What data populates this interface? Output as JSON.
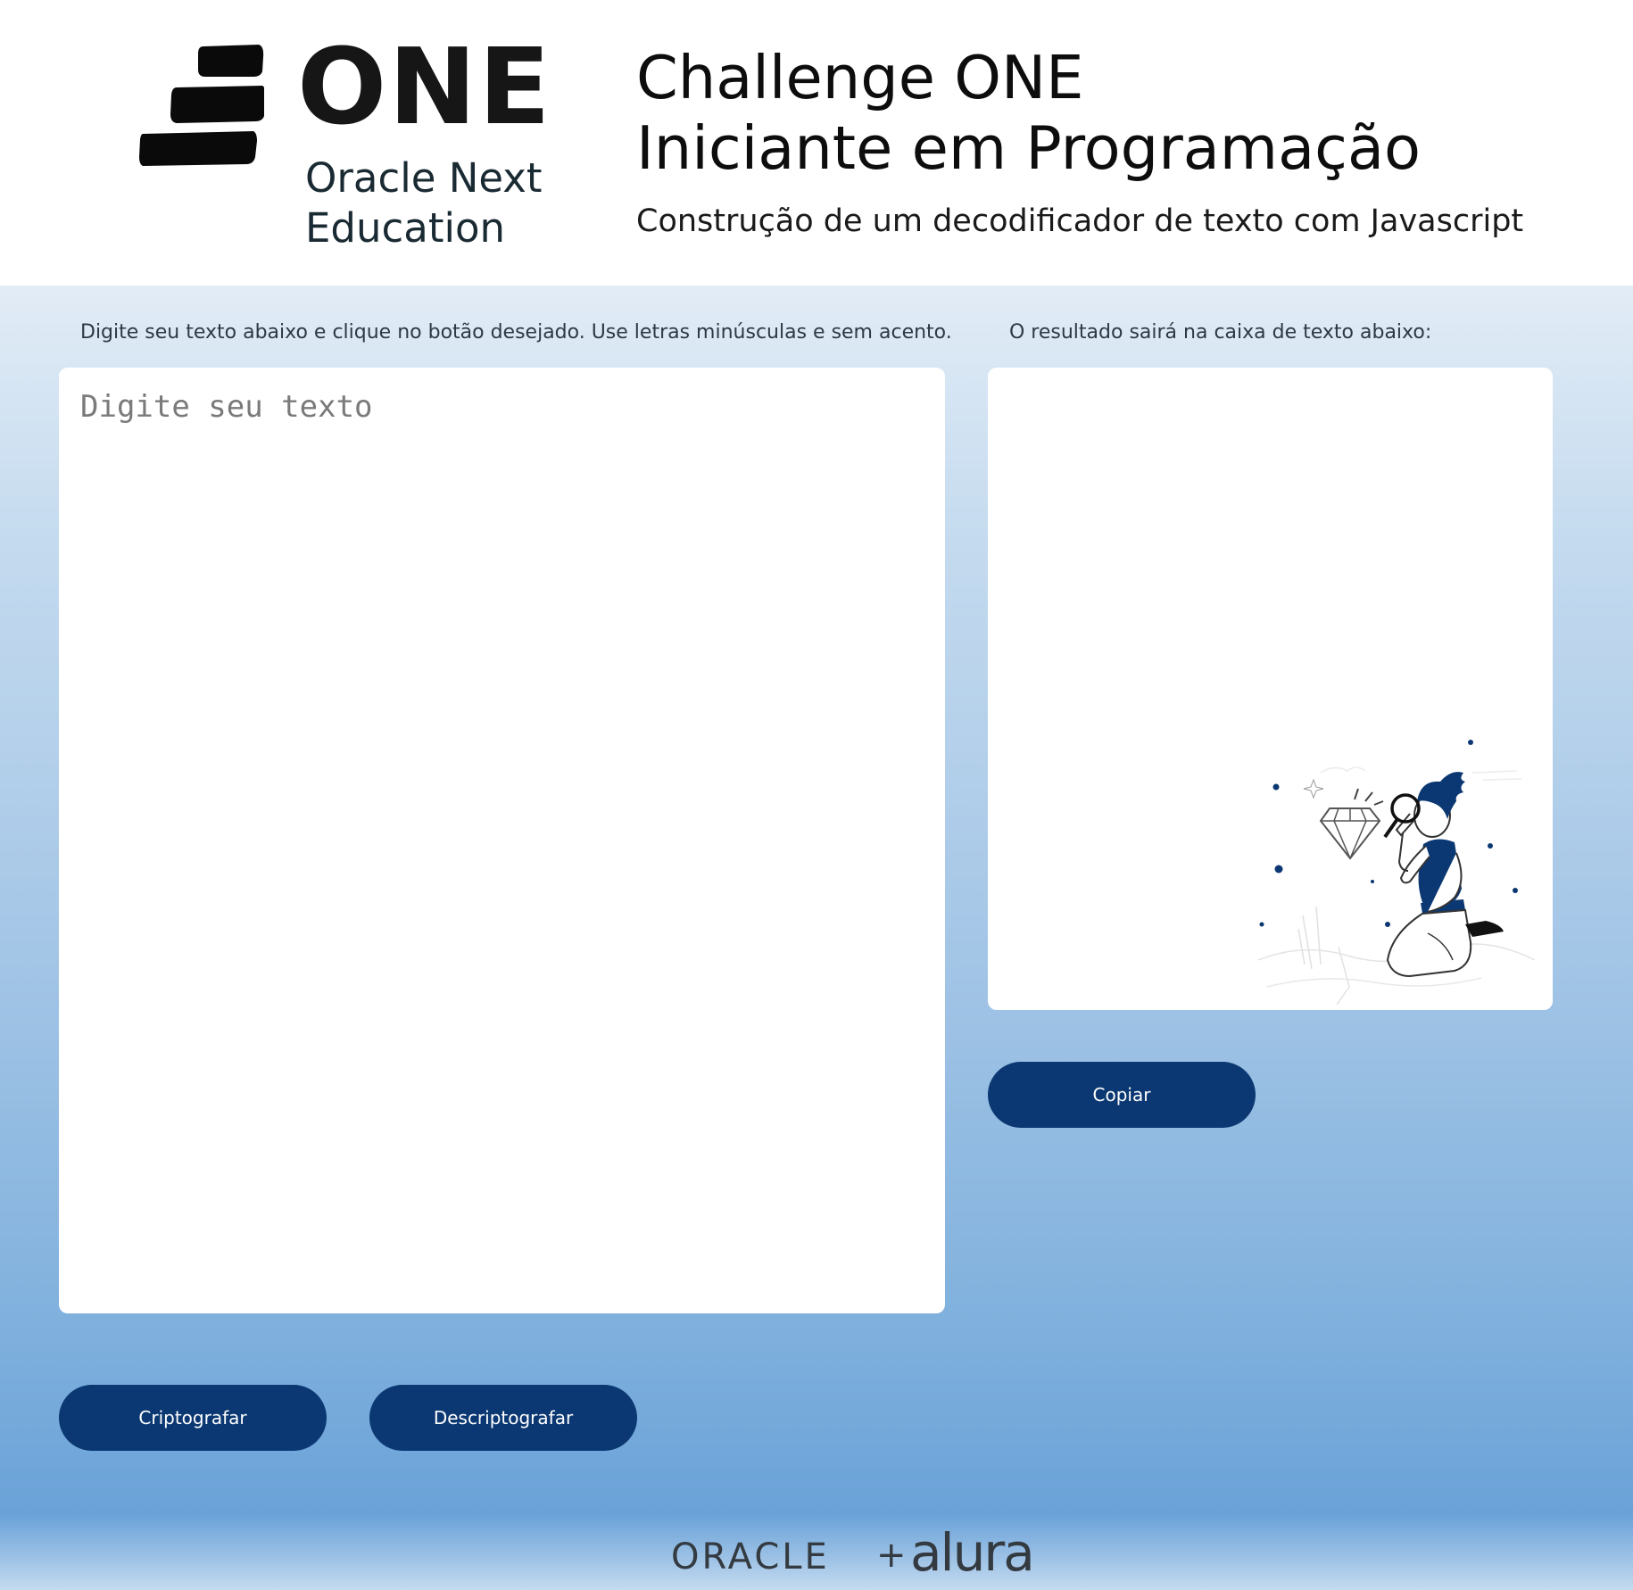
{
  "header": {
    "logo_word": "ONE",
    "logo_sub_line1": "Oracle Next",
    "logo_sub_line2": "Education",
    "title_line1": "Challenge ONE",
    "title_line2": "Iniciante em Programação",
    "subtitle": "Construção de um decodificador de texto com Javascript"
  },
  "input_panel": {
    "instruction": "Digite seu texto abaixo e clique no botão desejado. Use letras minúsculas e sem acento.",
    "placeholder": "Digite seu texto",
    "value": ""
  },
  "output_panel": {
    "instruction": "O resultado sairá na caixa de texto abaixo:",
    "value": "",
    "illustration": "person-with-magnifier-looking-at-diamond"
  },
  "buttons": {
    "encrypt": "Criptografar",
    "decrypt": "Descriptografar",
    "copy": "Copiar"
  },
  "footer": {
    "brand_left": "ORACLE",
    "separator": "+",
    "brand_right": "alura"
  },
  "colors": {
    "button_bg": "#0b3872",
    "button_text": "#ffffff",
    "gradient_top": "#e2ecf6",
    "gradient_bottom": "#6aa2d8"
  }
}
